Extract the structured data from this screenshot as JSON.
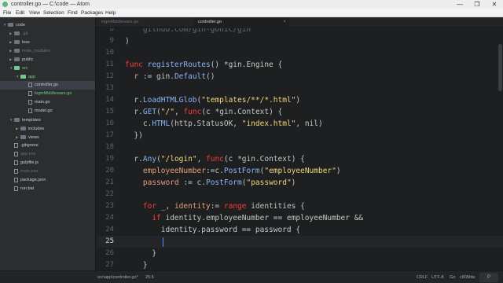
{
  "window": {
    "title": "controller.go — C:\\code — Atom",
    "buttons": {
      "minimize": "—",
      "maximize": "❐",
      "close": "✕"
    }
  },
  "menu": [
    "File",
    "Edit",
    "View",
    "Selection",
    "Find",
    "Packages",
    "Help"
  ],
  "tree": {
    "items": [
      {
        "label": "code",
        "kind": "folder",
        "state": "open",
        "style": "normal"
      },
      {
        "label": ".git",
        "kind": "folder",
        "state": "closed",
        "style": "muted"
      },
      {
        "label": "less",
        "kind": "folder",
        "state": "closed",
        "style": "normal"
      },
      {
        "label": "node_modules",
        "kind": "folder",
        "state": "closed",
        "style": "muted"
      },
      {
        "label": "public",
        "kind": "folder",
        "state": "closed",
        "style": "normal"
      },
      {
        "label": "src",
        "kind": "folder",
        "state": "open",
        "style": "green"
      },
      {
        "label": "app",
        "kind": "folder",
        "state": "open",
        "style": "green"
      },
      {
        "label": "controller.go",
        "kind": "file",
        "state": "",
        "style": "normal"
      },
      {
        "label": "loginMiddleware.go",
        "kind": "file",
        "state": "",
        "style": "green"
      },
      {
        "label": "main.go",
        "kind": "file",
        "state": "",
        "style": "normal"
      },
      {
        "label": "model.go",
        "kind": "file",
        "state": "",
        "style": "normal"
      },
      {
        "label": "templates",
        "kind": "folder",
        "state": "open",
        "style": "normal"
      },
      {
        "label": "includes",
        "kind": "folder",
        "state": "closed",
        "style": "normal"
      },
      {
        "label": "views",
        "kind": "folder",
        "state": "closed",
        "style": "normal"
      },
      {
        "label": ".gitignore",
        "kind": "file",
        "state": "",
        "style": "normal"
      },
      {
        "label": "app.exe",
        "kind": "file",
        "state": "",
        "style": "muted"
      },
      {
        "label": "gulpfile.js",
        "kind": "file",
        "state": "",
        "style": "normal"
      },
      {
        "label": "main.exe",
        "kind": "file",
        "state": "",
        "style": "muted"
      },
      {
        "label": "package.json",
        "kind": "file",
        "state": "",
        "style": "normal"
      },
      {
        "label": "run.bat",
        "kind": "file",
        "state": "",
        "style": "normal"
      }
    ]
  },
  "tabs": [
    {
      "label": "loginMiddleware.go",
      "active": false
    },
    {
      "label": "controller.go",
      "active": true
    }
  ],
  "editor": {
    "lines": [
      {
        "n": "8",
        "tokens": [
          [
            "    github.com/gin-gonic/gin",
            "fade"
          ]
        ]
      },
      {
        "n": "9",
        "tokens": [
          [
            ")",
            "plain"
          ]
        ]
      },
      {
        "n": "10",
        "tokens": [
          [
            "",
            "plain"
          ]
        ]
      },
      {
        "n": "11",
        "tokens": [
          [
            "func ",
            "kw"
          ],
          [
            "registerRoutes",
            "fn"
          ],
          [
            "() *gin.Engine {",
            "plain"
          ]
        ]
      },
      {
        "n": "12",
        "tokens": [
          [
            "  r ",
            "var"
          ],
          [
            ":= gin.",
            "plain"
          ],
          [
            "Default",
            "fn"
          ],
          [
            "()",
            "plain"
          ]
        ]
      },
      {
        "n": "13",
        "tokens": [
          [
            "",
            "plain"
          ]
        ]
      },
      {
        "n": "14",
        "tokens": [
          [
            "  r.",
            "plain"
          ],
          [
            "LoadHTMLGlob",
            "fn"
          ],
          [
            "(",
            "plain"
          ],
          [
            "\"templates/**/*.html\"",
            "str"
          ],
          [
            ")",
            "plain"
          ]
        ]
      },
      {
        "n": "15",
        "tokens": [
          [
            "  r.",
            "plain"
          ],
          [
            "GET",
            "fn"
          ],
          [
            "(",
            "plain"
          ],
          [
            "\"/\"",
            "str"
          ],
          [
            ", ",
            "plain"
          ],
          [
            "func",
            "kw"
          ],
          [
            "(c *gin.Context) {",
            "plain"
          ]
        ]
      },
      {
        "n": "16",
        "tokens": [
          [
            "    c.",
            "plain"
          ],
          [
            "HTML",
            "fn"
          ],
          [
            "(http.StatusOK, ",
            "plain"
          ],
          [
            "\"index.html\"",
            "str"
          ],
          [
            ", nil)",
            "plain"
          ]
        ]
      },
      {
        "n": "17",
        "tokens": [
          [
            "  })",
            "plain"
          ]
        ]
      },
      {
        "n": "18",
        "tokens": [
          [
            "",
            "plain"
          ]
        ]
      },
      {
        "n": "19",
        "tokens": [
          [
            "  r.",
            "plain"
          ],
          [
            "Any",
            "fn"
          ],
          [
            "(",
            "plain"
          ],
          [
            "\"/login\"",
            "str"
          ],
          [
            ", ",
            "plain"
          ],
          [
            "func",
            "kw"
          ],
          [
            "(c *gin.Context) {",
            "plain"
          ]
        ]
      },
      {
        "n": "20",
        "tokens": [
          [
            "    employeeNumber",
            "var"
          ],
          [
            ":=c.",
            "plain"
          ],
          [
            "PostForm",
            "fn"
          ],
          [
            "(",
            "plain"
          ],
          [
            "\"employeeNumber\"",
            "str"
          ],
          [
            ")",
            "plain"
          ]
        ]
      },
      {
        "n": "21",
        "tokens": [
          [
            "    password ",
            "var"
          ],
          [
            ":= c.",
            "plain"
          ],
          [
            "PostForm",
            "fn"
          ],
          [
            "(",
            "plain"
          ],
          [
            "\"password\"",
            "str"
          ],
          [
            ")",
            "plain"
          ]
        ]
      },
      {
        "n": "22",
        "tokens": [
          [
            "",
            "plain"
          ]
        ]
      },
      {
        "n": "23",
        "tokens": [
          [
            "    for ",
            "kw"
          ],
          [
            "_, ",
            "plain"
          ],
          [
            "identity",
            "var"
          ],
          [
            ":= ",
            "plain"
          ],
          [
            "range ",
            "kw"
          ],
          [
            "identities {",
            "plain"
          ]
        ]
      },
      {
        "n": "24",
        "tokens": [
          [
            "      if ",
            "kw"
          ],
          [
            "identity.employeeNumber == employeeNumber &&",
            "plain"
          ]
        ]
      },
      {
        "n": "24",
        "tokens": [
          [
            "        identity.password == password {",
            "plain"
          ]
        ]
      },
      {
        "n": "25",
        "tokens": [
          [
            "",
            "plain"
          ]
        ],
        "current": true
      },
      {
        "n": "26",
        "tokens": [
          [
            "      }",
            "plain"
          ]
        ]
      },
      {
        "n": "27",
        "tokens": [
          [
            "    }",
            "plain"
          ]
        ]
      }
    ]
  },
  "status": {
    "path": "src\\app\\controller.go*",
    "position": "25:5",
    "line_ending": "CRLF",
    "encoding": "UTF-8",
    "grammar": "Go",
    "branch": "c805fde",
    "logo": "P"
  },
  "colors": {
    "keyword": "#ff3b3b",
    "function": "#8ab4f8",
    "string": "#f5d67b",
    "variable": "#e8a07a",
    "git_added": "#73c990"
  }
}
